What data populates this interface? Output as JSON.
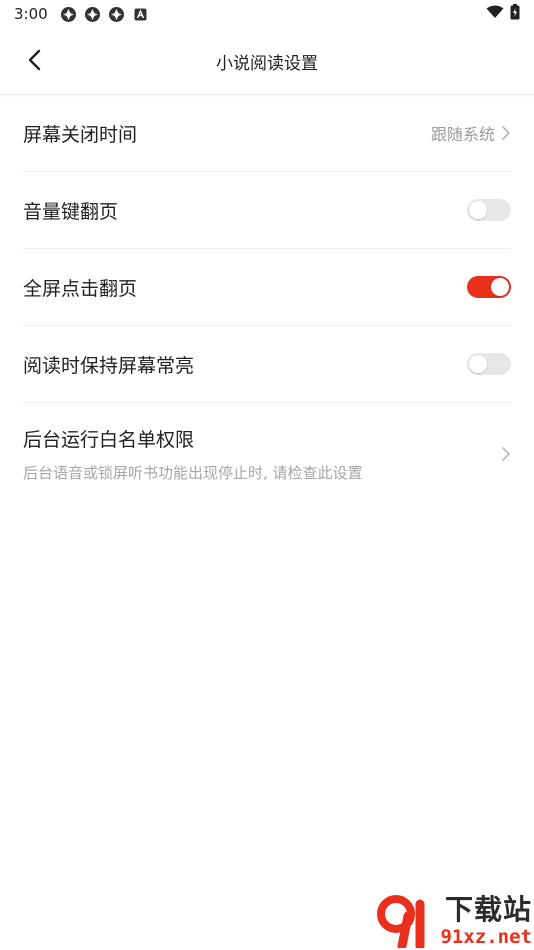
{
  "status_bar": {
    "time": "3:00"
  },
  "header": {
    "title": "小说阅读设置"
  },
  "settings": [
    {
      "label": "屏幕关闭时间",
      "value": "跟随系统"
    },
    {
      "label": "音量键翻页",
      "toggle": false
    },
    {
      "label": "全屏点击翻页",
      "toggle": true
    },
    {
      "label": "阅读时保持屏幕常亮",
      "toggle": false
    },
    {
      "label": "后台运行白名单权限",
      "sub": "后台语音或锁屏听书功能出现停止时, 请检查此设置"
    }
  ],
  "watermark": {
    "title": "下载站",
    "domain": "91xz.net"
  },
  "colors": {
    "accent": "#e8301c",
    "toggle_off": "#e7e7e7"
  }
}
